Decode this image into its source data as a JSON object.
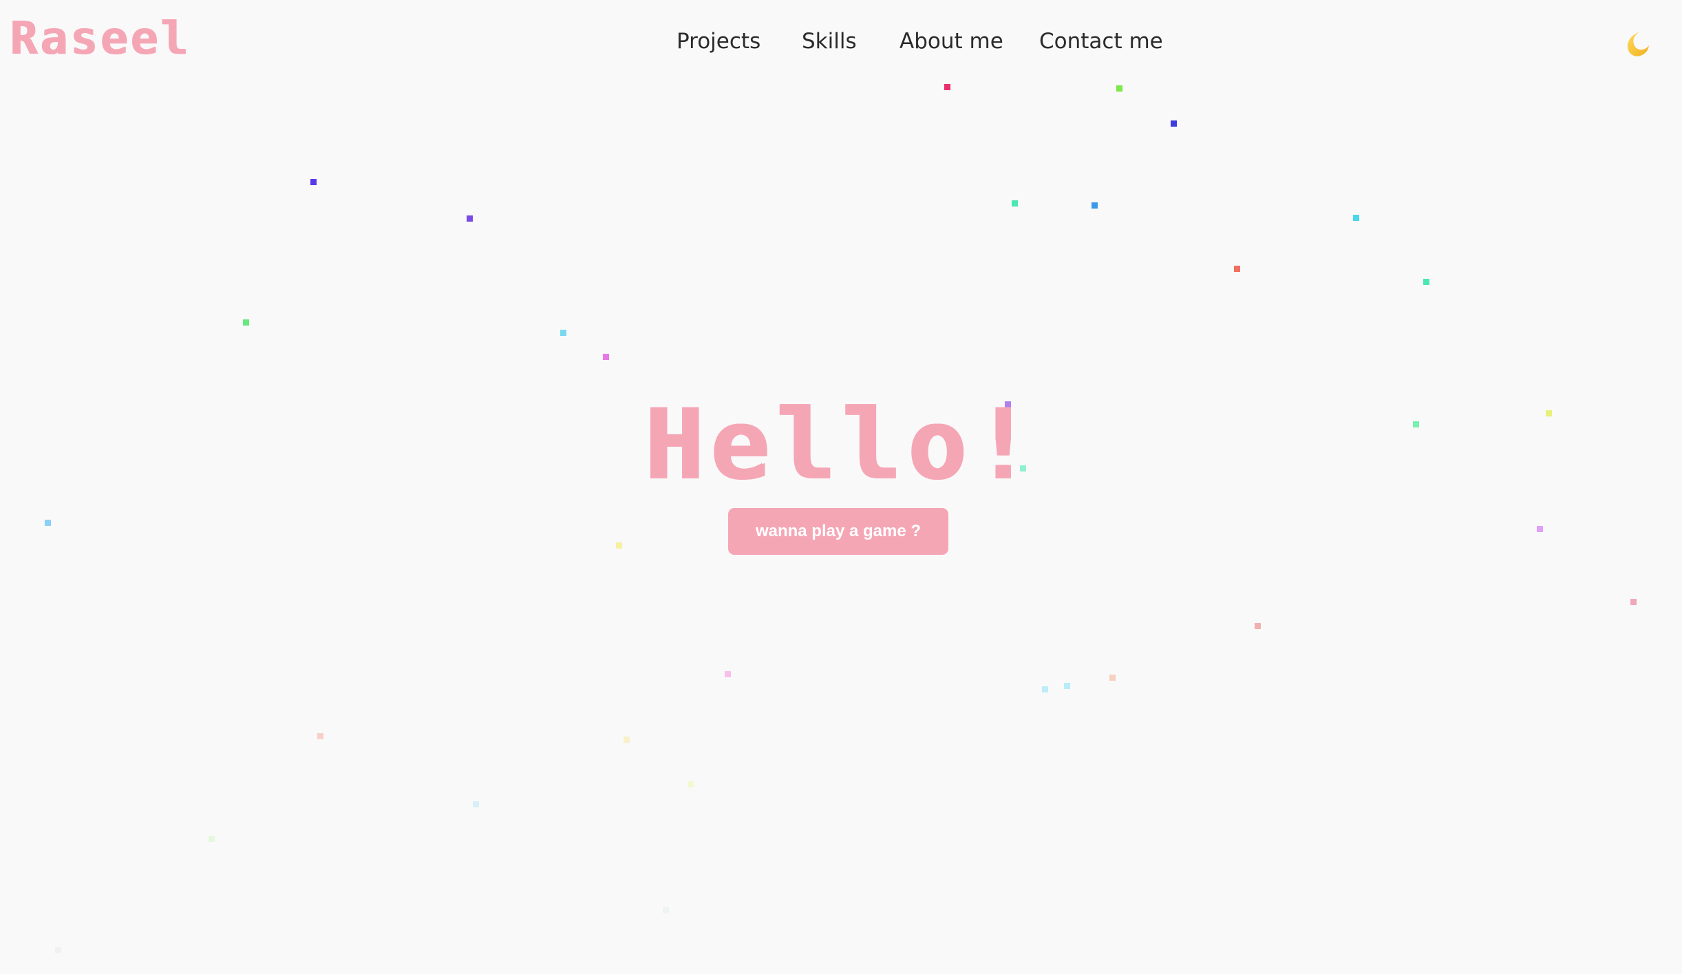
{
  "header": {
    "logo_text": "Raseel",
    "nav": [
      {
        "label": "Projects"
      },
      {
        "label": "Skills"
      },
      {
        "label": "About me"
      },
      {
        "label": "Contact me"
      }
    ],
    "theme_toggle_icon": "crescent-moon-icon"
  },
  "hero": {
    "title": "Hello!",
    "button_label": "wanna play a game ?"
  },
  "colors": {
    "background": "#f9f9f9",
    "accent_pink": "#f5a6b5",
    "nav_text": "#2b2b2b",
    "button_text": "#ffffff",
    "moon": "#f7c531"
  }
}
